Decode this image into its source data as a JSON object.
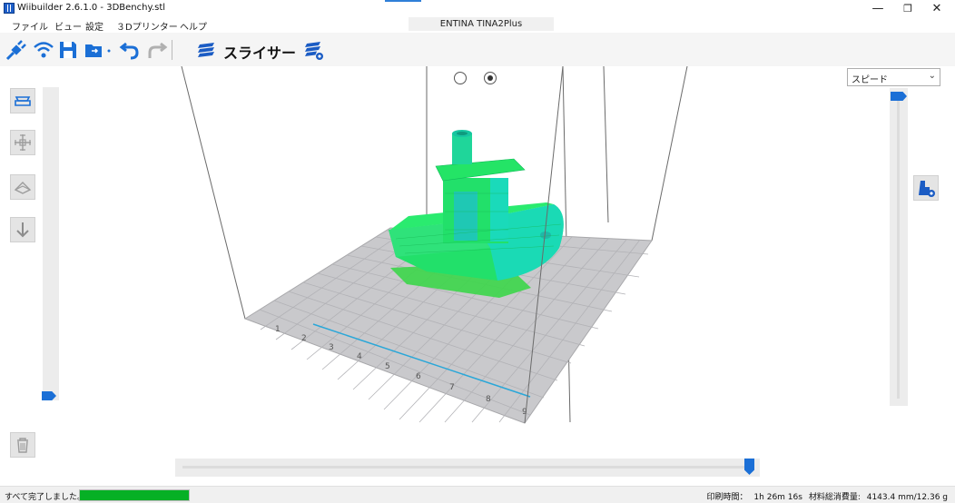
{
  "window": {
    "title": "Wiibuilder 2.6.1.0 - 3DBenchy.stl",
    "printer": "ENTINA TINA2Plus",
    "minimize": "—",
    "restore": "❐",
    "close": "✕"
  },
  "menu": [
    "ファイル",
    "ビュー",
    "設定",
    "３Dプリンター",
    "ヘルプ"
  ],
  "toolbar": {
    "slicer_label": "スライサー",
    "icons": [
      "connect-icon",
      "wifi-icon",
      "save-icon",
      "open-folder-icon",
      "undo-icon",
      "redo-icon",
      "slicer-layers-icon",
      "slice-settings-icon"
    ]
  },
  "view": {
    "view_mode_options": [
      "model",
      "preview"
    ],
    "view_mode_selected": "preview",
    "color_mode": "スピード",
    "bed_ruler_ticks": [
      "1",
      "2",
      "3",
      "4",
      "5",
      "6",
      "7",
      "8",
      "9"
    ],
    "layer_slider_fraction": 1.0,
    "progress_slider_fraction": 0.98
  },
  "colors": {
    "accent": "#1b6fd6",
    "model_green": "#22e06a",
    "model_cyan": "#19d8c8",
    "bed": "#c9c9cc",
    "progress": "#06b025"
  },
  "status": {
    "message": "すべて完了しました。",
    "progress_fraction": 1.0,
    "print_time_label": "印刷時間：",
    "print_time": "1h 26m 16s",
    "material_label": "材料総消費量:",
    "material": "4143.4 mm/12.36 g"
  }
}
